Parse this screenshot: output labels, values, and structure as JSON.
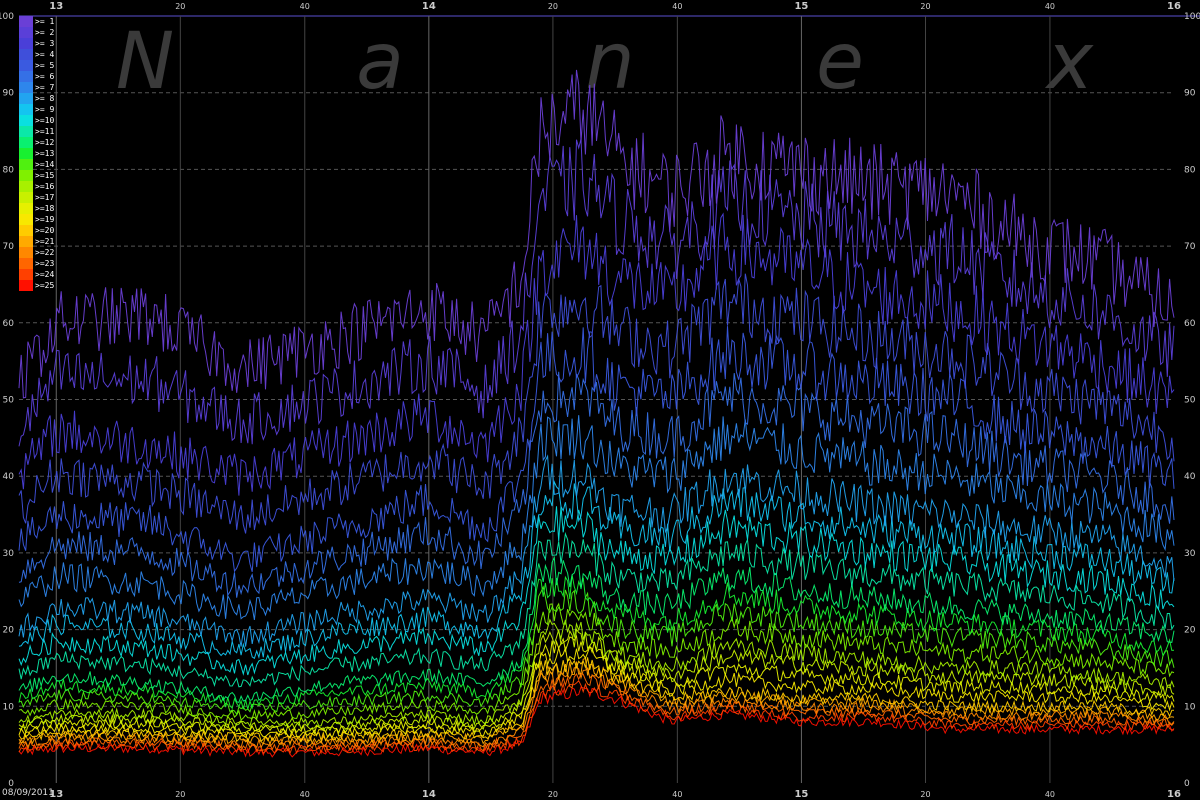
{
  "watermark": [
    "N",
    "a",
    "n",
    "e",
    "x"
  ],
  "date_label": "08/09/2011",
  "chart_data": {
    "type": "line",
    "title": "",
    "xlabel": "",
    "ylabel": "",
    "ylim": [
      0,
      100
    ],
    "y_ticks": [
      0,
      10,
      20,
      30,
      40,
      50,
      60,
      70,
      80,
      90,
      100
    ],
    "x_tick_labels": [
      "13",
      "20",
      "40",
      "14",
      "20",
      "40",
      "15",
      "20",
      "40",
      "16"
    ],
    "x_tick_hours": [
      13,
      13.333,
      13.667,
      14,
      14.333,
      14.667,
      15,
      15.333,
      15.667,
      16
    ],
    "xlim": [
      12.9,
      16
    ],
    "grid": true,
    "legend_position": "top-left",
    "legend": [
      ">= 1",
      ">= 2",
      ">= 3",
      ">= 4",
      ">= 5",
      ">= 6",
      ">= 7",
      ">= 8",
      ">= 9",
      ">=10",
      ">=11",
      ">=12",
      ">=13",
      ">=14",
      ">=15",
      ">=16",
      ">=17",
      ">=18",
      ">=19",
      ">=20",
      ">=21",
      ">=22",
      ">=23",
      ">=24",
      ">=25"
    ],
    "colors": [
      "#6a3fd6",
      "#5a3fd8",
      "#4a3fd8",
      "#3f4fda",
      "#3a5ae0",
      "#3570e6",
      "#2e86ec",
      "#22a4f0",
      "#14c4f0",
      "#0ae0e0",
      "#0be8a8",
      "#0af070",
      "#18f030",
      "#50f010",
      "#80f000",
      "#a8f000",
      "#c8f000",
      "#e6f000",
      "#f8e800",
      "#ffcc00",
      "#ffaa00",
      "#ff8800",
      "#ff6600",
      "#ff4000",
      "#ff1000"
    ],
    "series": [
      {
        "name": ">= 1",
        "x": [
          12.9,
          13.0,
          13.25,
          13.5,
          13.75,
          14.0,
          14.15,
          14.25,
          14.3,
          14.42,
          14.5,
          14.65,
          14.8,
          15.0,
          15.2,
          15.4,
          15.6,
          15.8,
          16.0
        ],
        "values": [
          52,
          60,
          61,
          54,
          58,
          62,
          58,
          66,
          85,
          88,
          82,
          77,
          82,
          80,
          78,
          77,
          71,
          68,
          62
        ]
      },
      {
        "name": ">= 3",
        "x": [
          12.9,
          13.0,
          13.25,
          13.5,
          13.75,
          14.0,
          14.15,
          14.25,
          14.3,
          14.42,
          14.5,
          14.65,
          14.8,
          15.0,
          15.2,
          15.4,
          15.6,
          15.8,
          16.0
        ],
        "values": [
          40,
          46,
          44,
          40,
          44,
          48,
          44,
          52,
          68,
          70,
          66,
          63,
          70,
          67,
          64,
          62,
          58,
          55,
          50
        ]
      },
      {
        "name": ">= 5",
        "x": [
          12.9,
          13.0,
          13.25,
          13.5,
          13.75,
          14.0,
          14.15,
          14.25,
          14.3,
          14.42,
          14.5,
          14.65,
          14.8,
          15.0,
          15.2,
          15.4,
          15.6,
          15.8,
          16.0
        ],
        "values": [
          31,
          35,
          34,
          29,
          33,
          37,
          33,
          40,
          55,
          56,
          52,
          50,
          56,
          54,
          52,
          50,
          46,
          44,
          40
        ]
      },
      {
        "name": ">= 8",
        "x": [
          12.9,
          13.0,
          13.25,
          13.5,
          13.75,
          14.0,
          14.15,
          14.25,
          14.3,
          14.42,
          14.5,
          14.65,
          14.8,
          15.0,
          15.2,
          15.4,
          15.6,
          15.8,
          16.0
        ],
        "values": [
          20,
          23,
          22,
          19,
          22,
          24,
          22,
          27,
          40,
          40,
          36,
          35,
          40,
          38,
          36,
          35,
          33,
          32,
          28
        ]
      },
      {
        "name": ">=12",
        "x": [
          12.9,
          13.0,
          13.25,
          13.5,
          13.75,
          14.0,
          14.15,
          14.25,
          14.3,
          14.42,
          14.5,
          14.65,
          14.8,
          15.0,
          15.2,
          15.4,
          15.6,
          15.8,
          16.0
        ],
        "values": [
          12,
          14,
          13,
          11,
          13,
          14,
          13,
          16,
          28,
          27,
          24,
          23,
          27,
          25,
          24,
          23,
          22,
          21,
          19
        ]
      },
      {
        "name": ">=16",
        "x": [
          12.9,
          13.0,
          13.25,
          13.5,
          13.75,
          14.0,
          14.15,
          14.25,
          14.3,
          14.42,
          14.5,
          14.65,
          14.8,
          15.0,
          15.2,
          15.4,
          15.6,
          15.8,
          16.0
        ],
        "values": [
          8,
          9,
          9,
          8,
          8,
          9,
          8,
          11,
          20,
          20,
          17,
          15,
          18,
          17,
          16,
          15,
          15,
          14,
          13
        ]
      },
      {
        "name": ">=20",
        "x": [
          12.9,
          13.0,
          13.25,
          13.5,
          13.75,
          14.0,
          14.15,
          14.25,
          14.3,
          14.42,
          14.5,
          14.65,
          14.8,
          15.0,
          15.2,
          15.4,
          15.6,
          15.8,
          16.0
        ],
        "values": [
          6,
          6.5,
          6.5,
          6,
          6,
          6.5,
          6,
          8,
          15,
          16,
          14,
          11,
          12,
          11,
          11,
          10,
          10,
          10,
          9
        ]
      },
      {
        "name": ">=25",
        "x": [
          12.9,
          13.0,
          13.25,
          13.5,
          13.75,
          14.0,
          14.15,
          14.25,
          14.3,
          14.42,
          14.5,
          14.65,
          14.8,
          15.0,
          15.2,
          15.4,
          15.6,
          15.8,
          16.0
        ],
        "values": [
          4,
          4.5,
          4.5,
          4,
          4,
          4.5,
          4,
          5,
          11,
          12,
          11,
          8,
          9,
          8,
          8,
          7,
          7,
          7,
          7
        ]
      }
    ]
  }
}
